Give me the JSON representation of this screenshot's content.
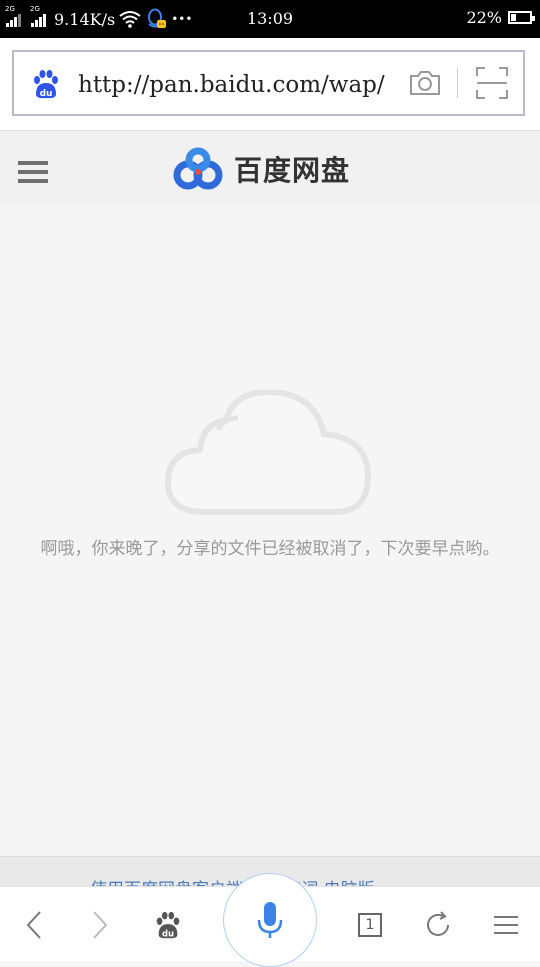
{
  "status_bar": {
    "network_speed": "9.14K/s",
    "sim1_label": "2G",
    "sim2_label": "2G",
    "time": "13:09",
    "battery": "22%",
    "overflow": "•••"
  },
  "address_bar": {
    "url": "http://pan.baidu.com/wap/"
  },
  "site_header": {
    "brand": "百度网盘"
  },
  "main": {
    "message": "啊哦，你来晚了，分享的文件已经被取消了，下次要早点哟。"
  },
  "footer_link": {
    "text": "使用百度网盘客户端 MST实词    电脑版"
  },
  "toolbar": {
    "tab_count": "1"
  },
  "colors": {
    "baidu_blue": "#2f54eb",
    "mic_blue": "#3b83e6",
    "link_blue": "#4a78b8"
  }
}
